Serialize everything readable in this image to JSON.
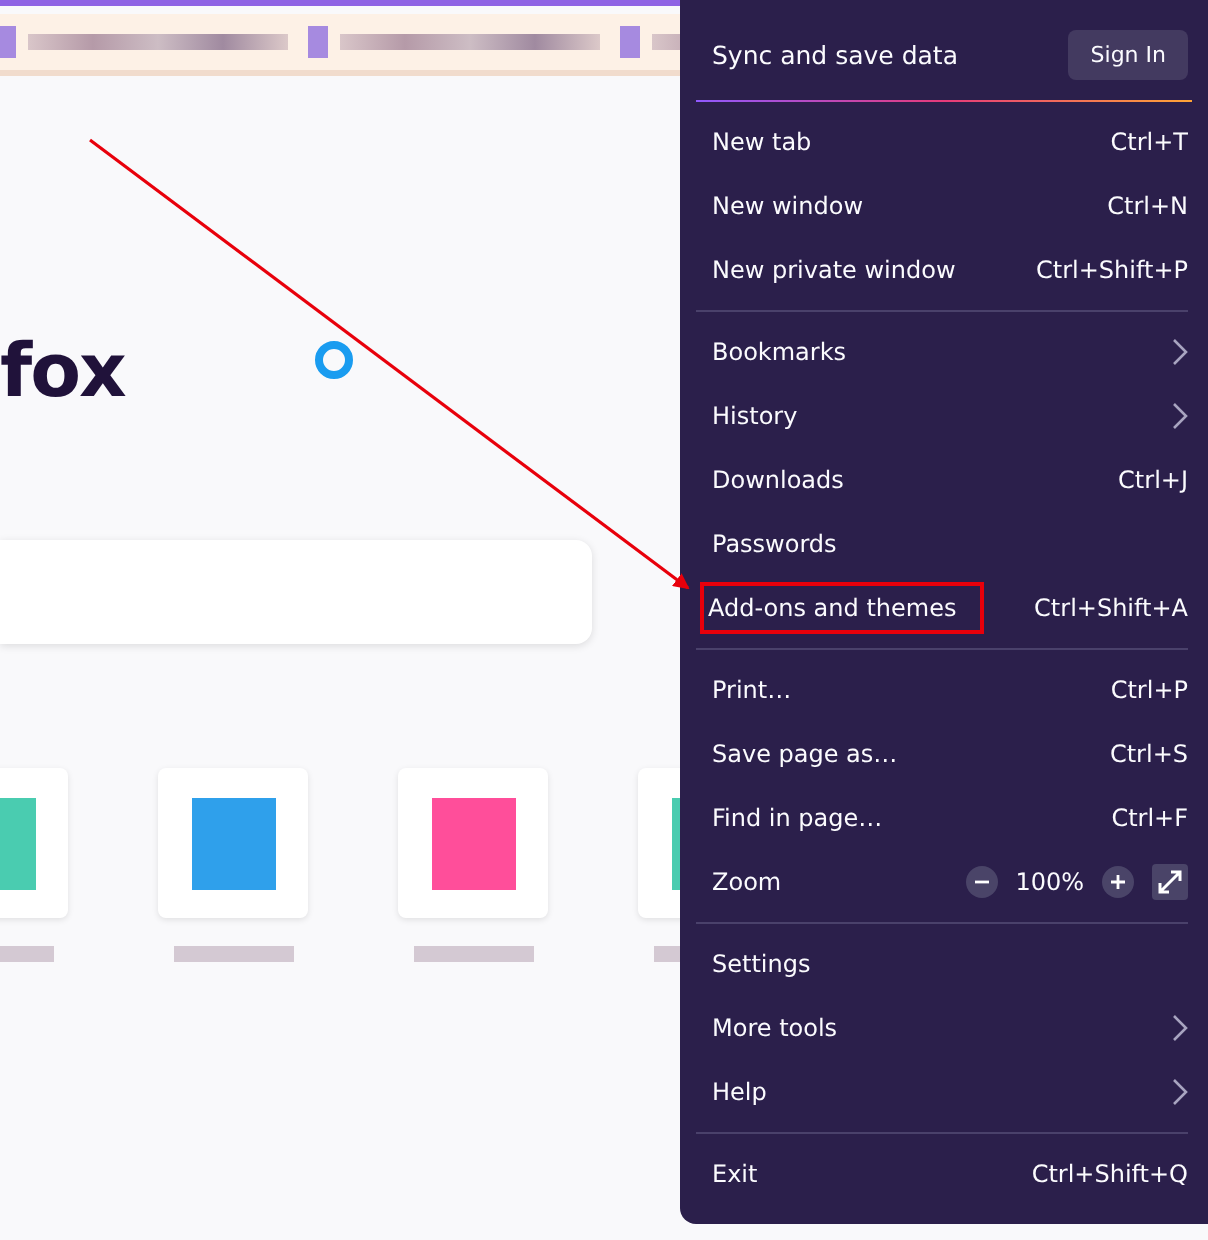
{
  "page": {
    "logo": "fox"
  },
  "menu": {
    "header": {
      "label": "Sync and save data",
      "button": "Sign In"
    },
    "sections": [
      {
        "items": [
          {
            "kind": "shortcut",
            "label": "New tab",
            "shortcut": "Ctrl+T",
            "highlighted": false
          },
          {
            "kind": "shortcut",
            "label": "New window",
            "shortcut": "Ctrl+N",
            "highlighted": false
          },
          {
            "kind": "shortcut",
            "label": "New private window",
            "shortcut": "Ctrl+Shift+P",
            "highlighted": false
          }
        ]
      },
      {
        "items": [
          {
            "kind": "submenu",
            "label": "Bookmarks",
            "highlighted": false
          },
          {
            "kind": "submenu",
            "label": "History",
            "highlighted": false
          },
          {
            "kind": "shortcut",
            "label": "Downloads",
            "shortcut": "Ctrl+J",
            "highlighted": false
          },
          {
            "kind": "plain",
            "label": "Passwords",
            "highlighted": false
          },
          {
            "kind": "shortcut",
            "label": "Add-ons and themes",
            "shortcut": "Ctrl+Shift+A",
            "highlighted": true
          }
        ]
      },
      {
        "items": [
          {
            "kind": "shortcut",
            "label": "Print…",
            "shortcut": "Ctrl+P",
            "highlighted": false
          },
          {
            "kind": "shortcut",
            "label": "Save page as…",
            "shortcut": "Ctrl+S",
            "highlighted": false
          },
          {
            "kind": "shortcut",
            "label": "Find in page…",
            "shortcut": "Ctrl+F",
            "highlighted": false
          },
          {
            "kind": "zoom",
            "label": "Zoom",
            "value": "100%",
            "highlighted": false
          }
        ]
      },
      {
        "items": [
          {
            "kind": "plain",
            "label": "Settings",
            "highlighted": false
          },
          {
            "kind": "submenu",
            "label": "More tools",
            "highlighted": false
          },
          {
            "kind": "submenu",
            "label": "Help",
            "highlighted": false
          }
        ]
      },
      {
        "items": [
          {
            "kind": "shortcut",
            "label": "Exit",
            "shortcut": "Ctrl+Shift+Q",
            "highlighted": false
          }
        ]
      }
    ]
  }
}
